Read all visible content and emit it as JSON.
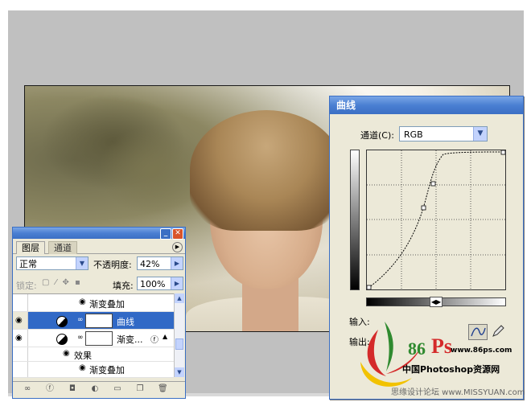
{
  "curves": {
    "title": "曲线",
    "channel_label": "通道(C):",
    "channel_value": "RGB",
    "input_label": "输入:",
    "output_label": "输出:"
  },
  "layers": {
    "tab_active": "图层",
    "tab_inactive": "通道",
    "blend_mode": "正常",
    "opacity_label": "不透明度:",
    "opacity_value": "42%",
    "lock_label": "锁定:",
    "fill_label": "填充:",
    "fill_value": "100%",
    "rows": [
      {
        "label": "渐变叠加"
      },
      {
        "label": "曲线"
      },
      {
        "label": "渐变..."
      },
      {
        "label": "效果"
      },
      {
        "label": "渐变叠加"
      }
    ]
  },
  "logo": {
    "number": "86",
    "site": "www.86ps.com",
    "name": "中国Photoshop资源网"
  },
  "watermark": "思缘设计论坛 www.MISSYUAN.com",
  "colors": {
    "titlebar": "#4a7fd2",
    "selected_row": "#3169c6",
    "panel_bg": "#ece9d8",
    "logo_red": "#d42a2a",
    "logo_green": "#2f8a2f",
    "logo_yellow": "#f2c200"
  }
}
